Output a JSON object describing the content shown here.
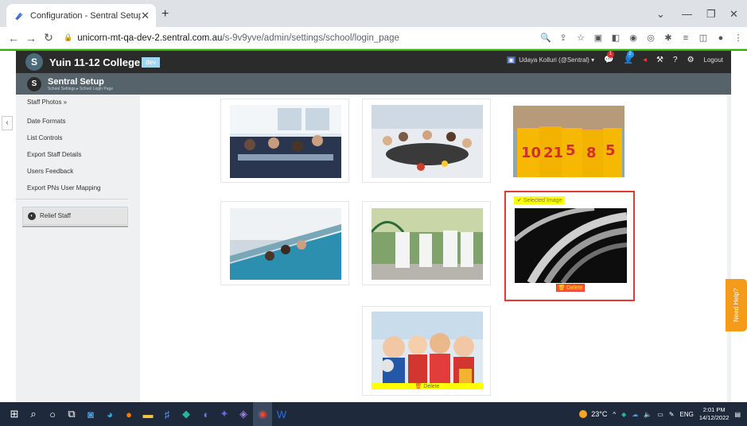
{
  "browser": {
    "tab_title": "Configuration - Sentral Setup",
    "url_domain": "unicorn-mt-qa-dev-2.sentral.com.au",
    "url_path": "/s-9v9yve/admin/settings/school/login_page"
  },
  "app": {
    "school_name": "Yuin 11-12 College",
    "env_badge": "dev",
    "user": "Udaya Kolluri (@Sentral) ▾",
    "notif_1": "1",
    "notif_2": "2",
    "logout": "Logout"
  },
  "subheader": {
    "title": "Sentral Setup",
    "breadcrumb": "School Settings ▸ School Login Page"
  },
  "sidebar": {
    "items": [
      {
        "label": "Staff Photos »"
      },
      {
        "label": "Date Formats"
      },
      {
        "label": "List Controls"
      },
      {
        "label": "Export Staff Details"
      },
      {
        "label": "Users Feedback"
      },
      {
        "label": "Export PNs User Mapping"
      }
    ],
    "relief": "Relief Staff"
  },
  "gallery": {
    "selected_label": "Selected Image",
    "delete_label": "Delete"
  },
  "help": {
    "label": "Need Help?"
  },
  "taskbar": {
    "temperature": "23°C",
    "lang": "ENG",
    "time": "2:01 PM",
    "date": "14/12/2022"
  }
}
